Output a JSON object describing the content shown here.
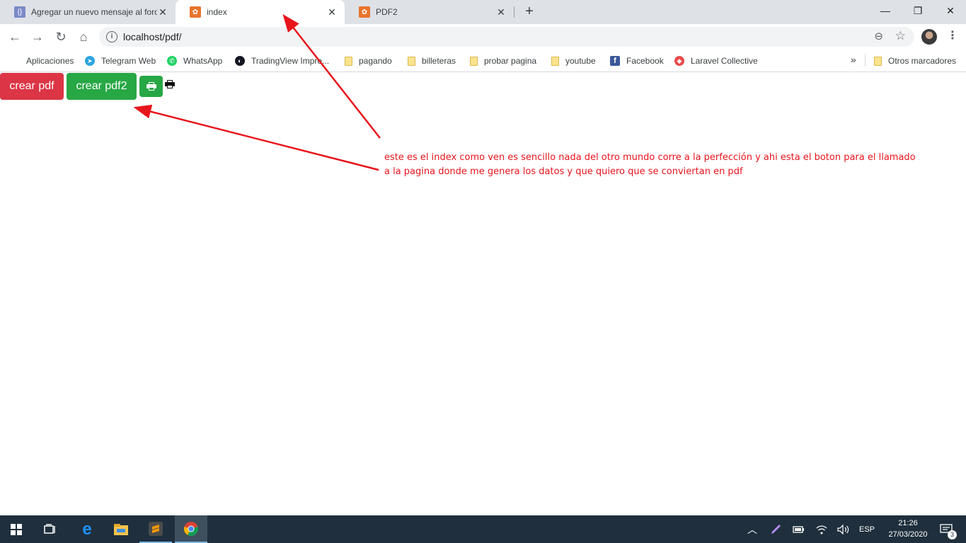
{
  "tabs": [
    {
      "title": "Agregar un nuevo mensaje al foro",
      "icon": "code-braces-icon",
      "active": false
    },
    {
      "title": "index",
      "icon": "xampp-icon",
      "active": true
    },
    {
      "title": "PDF2",
      "icon": "xampp-icon",
      "active": false
    }
  ],
  "tab_close_glyph": "✕",
  "new_tab_glyph": "+",
  "window_controls": {
    "minimize": "—",
    "restore": "❐",
    "close": "✕"
  },
  "nav": {
    "back": "←",
    "forward": "→",
    "reload": "↻",
    "home": "⌂"
  },
  "address": {
    "url": "localhost/pdf/",
    "info_glyph": "i",
    "zoom_glyph": "⊖",
    "star_glyph": "☆"
  },
  "menu_glyph": "⋮",
  "bookmarks": [
    {
      "label": "Aplicaciones",
      "icon": "apps-grid-icon"
    },
    {
      "label": "Telegram Web",
      "icon": "telegram-icon"
    },
    {
      "label": "WhatsApp",
      "icon": "whatsapp-icon"
    },
    {
      "label": "TradingView Impre...",
      "icon": "tradingview-icon"
    },
    {
      "label": "pagando",
      "icon": "folder-icon"
    },
    {
      "label": "billeteras",
      "icon": "folder-icon"
    },
    {
      "label": "probar pagina",
      "icon": "folder-icon"
    },
    {
      "label": "youtube",
      "icon": "folder-icon"
    },
    {
      "label": "Facebook",
      "icon": "facebook-icon"
    },
    {
      "label": "Laravel Collective",
      "icon": "laravel-icon"
    }
  ],
  "bookmarks_more": "»",
  "other_bookmarks": "Otros marcadores",
  "page": {
    "btn_crear_pdf": "crear pdf",
    "btn_crear_pdf2": "crear pdf2"
  },
  "annotation": "este es el index como ven es sencillo nada del otro mundo corre a la perfección y ahi esta el boton para el llamado a la pagina donde me genera los datos y que quiero que se conviertan en pdf",
  "colors": {
    "danger": "#dc3545",
    "success": "#28a745",
    "annotation": "#e8141c",
    "taskbar": "#1f2f3d"
  },
  "taskbar": {
    "language": "ESP",
    "time": "21:26",
    "date": "27/03/2020",
    "notifications": "3"
  }
}
